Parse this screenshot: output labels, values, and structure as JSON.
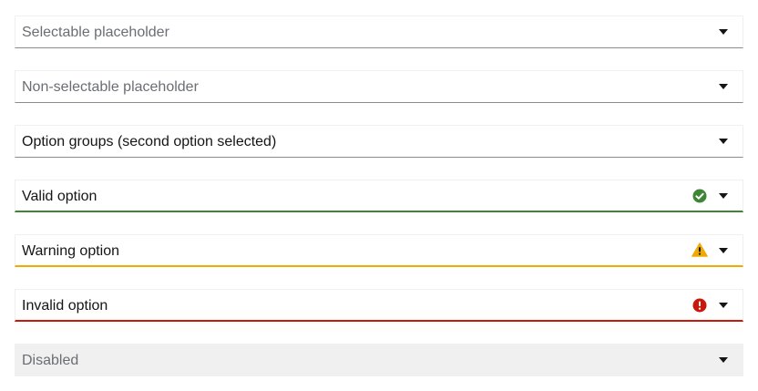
{
  "selects": [
    {
      "label": "Selectable placeholder",
      "placeholder": true,
      "status": null
    },
    {
      "label": "Non-selectable placeholder",
      "placeholder": true,
      "status": null
    },
    {
      "label": "Option groups (second option selected)",
      "placeholder": false,
      "status": null
    },
    {
      "label": "Valid option",
      "placeholder": false,
      "status": "success",
      "icon": "check-circle-icon"
    },
    {
      "label": "Warning option",
      "placeholder": false,
      "status": "warning",
      "icon": "warning-triangle-icon"
    },
    {
      "label": "Invalid option",
      "placeholder": false,
      "status": "error",
      "icon": "exclamation-circle-icon"
    },
    {
      "label": "Disabled",
      "placeholder": false,
      "status": "disabled"
    }
  ],
  "colors": {
    "success": "#3e8635",
    "warning": "#f0ab00",
    "error": "#c9190b",
    "disabled_bg": "#f0f0f0"
  },
  "icons": {
    "caret": "caret-down-icon"
  }
}
